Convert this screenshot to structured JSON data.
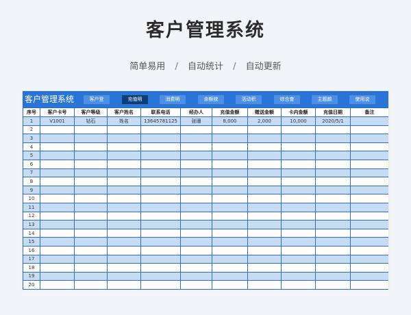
{
  "hero": {
    "title": "客户管理系统",
    "subtitle_parts": [
      "简单易用",
      "/",
      "自动统计",
      "/",
      "自动更新"
    ]
  },
  "toolbar": {
    "app_title": "客户管理系统",
    "buttons": [
      "客户登",
      "充值明",
      "消费明",
      "余额统",
      "活动积",
      "综合查",
      "主题颜",
      "使用说"
    ],
    "active_index": 1
  },
  "table": {
    "headers": [
      "序号",
      "客户卡号",
      "客户等级",
      "客户姓名",
      "联系电话",
      "经办人",
      "充值金额",
      "赠送金额",
      "卡内金额",
      "充值日期",
      "备注"
    ],
    "rows": [
      [
        "1",
        "V1001",
        "钻石",
        "姓名",
        "13645781125",
        "张珊",
        "8,000",
        "2,000",
        "10,000",
        "2020/5/1",
        ""
      ],
      [
        "2",
        "",
        "",
        "",
        "",
        "",
        "",
        "",
        "",
        "",
        ""
      ],
      [
        "3",
        "",
        "",
        "",
        "",
        "",
        "",
        "",
        "",
        "",
        ""
      ],
      [
        "4",
        "",
        "",
        "",
        "",
        "",
        "",
        "",
        "",
        "",
        ""
      ],
      [
        "5",
        "",
        "",
        "",
        "",
        "",
        "",
        "",
        "",
        "",
        ""
      ],
      [
        "6",
        "",
        "",
        "",
        "",
        "",
        "",
        "",
        "",
        "",
        ""
      ],
      [
        "7",
        "",
        "",
        "",
        "",
        "",
        "",
        "",
        "",
        "",
        ""
      ],
      [
        "8",
        "",
        "",
        "",
        "",
        "",
        "",
        "",
        "",
        "",
        ""
      ],
      [
        "9",
        "",
        "",
        "",
        "",
        "",
        "",
        "",
        "",
        "",
        ""
      ],
      [
        "10",
        "",
        "",
        "",
        "",
        "",
        "",
        "",
        "",
        "",
        ""
      ],
      [
        "11",
        "",
        "",
        "",
        "",
        "",
        "",
        "",
        "",
        "",
        ""
      ],
      [
        "12",
        "",
        "",
        "",
        "",
        "",
        "",
        "",
        "",
        "",
        ""
      ],
      [
        "13",
        "",
        "",
        "",
        "",
        "",
        "",
        "",
        "",
        "",
        ""
      ],
      [
        "14",
        "",
        "",
        "",
        "",
        "",
        "",
        "",
        "",
        "",
        ""
      ],
      [
        "15",
        "",
        "",
        "",
        "",
        "",
        "",
        "",
        "",
        "",
        ""
      ],
      [
        "16",
        "",
        "",
        "",
        "",
        "",
        "",
        "",
        "",
        "",
        ""
      ],
      [
        "17",
        "",
        "",
        "",
        "",
        "",
        "",
        "",
        "",
        "",
        ""
      ],
      [
        "18",
        "",
        "",
        "",
        "",
        "",
        "",
        "",
        "",
        "",
        ""
      ],
      [
        "19",
        "",
        "",
        "",
        "",
        "",
        "",
        "",
        "",
        "",
        ""
      ],
      [
        "20",
        "",
        "",
        "",
        "",
        "",
        "",
        "",
        "",
        "",
        ""
      ],
      [
        "",
        "",
        "",
        "",
        "",
        "",
        "",
        "",
        "",
        "",
        ""
      ]
    ]
  },
  "colors": {
    "toolbar_bg": "#2a74d6",
    "button_bg": "#4c8fe4",
    "button_active_bg": "#0f3d7a",
    "row_stripe": "#c6dcf5",
    "grid_line": "#2f6fc0"
  }
}
